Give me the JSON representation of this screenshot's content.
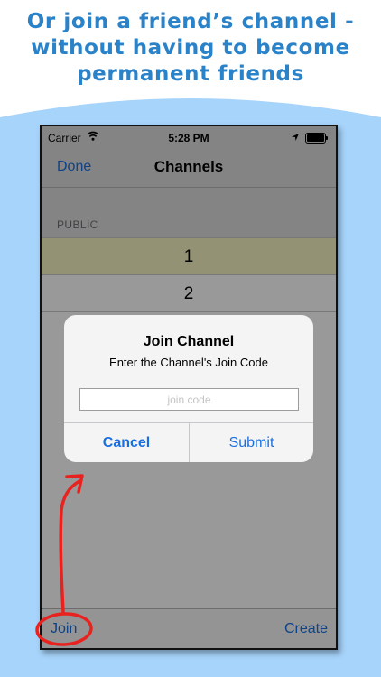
{
  "headline": {
    "line1": "Or join a friend’s channel -",
    "line2": "without having to become",
    "line3": "permanent friends"
  },
  "colors": {
    "headline": "#2a82c9",
    "backdrop": "#a7d4fb",
    "ios_blue": "#1a6fe0",
    "selected_row": "#f6f4c3",
    "annotation_red": "#e8231f"
  },
  "status_bar": {
    "carrier": "Carrier",
    "time": "5:28 PM",
    "icons": [
      "wifi-icon",
      "location-icon",
      "battery-icon"
    ]
  },
  "nav_bar": {
    "left_button": "Done",
    "title": "Channels"
  },
  "section": {
    "header": "PUBLIC",
    "rows": [
      {
        "label": "1",
        "selected": true
      },
      {
        "label": "2",
        "selected": false
      }
    ]
  },
  "dialog": {
    "title": "Join Channel",
    "message": "Enter the Channel's Join Code",
    "input_placeholder": "join code",
    "input_value": "",
    "cancel_label": "Cancel",
    "submit_label": "Submit"
  },
  "toolbar": {
    "join_label": "Join",
    "create_label": "Create"
  }
}
